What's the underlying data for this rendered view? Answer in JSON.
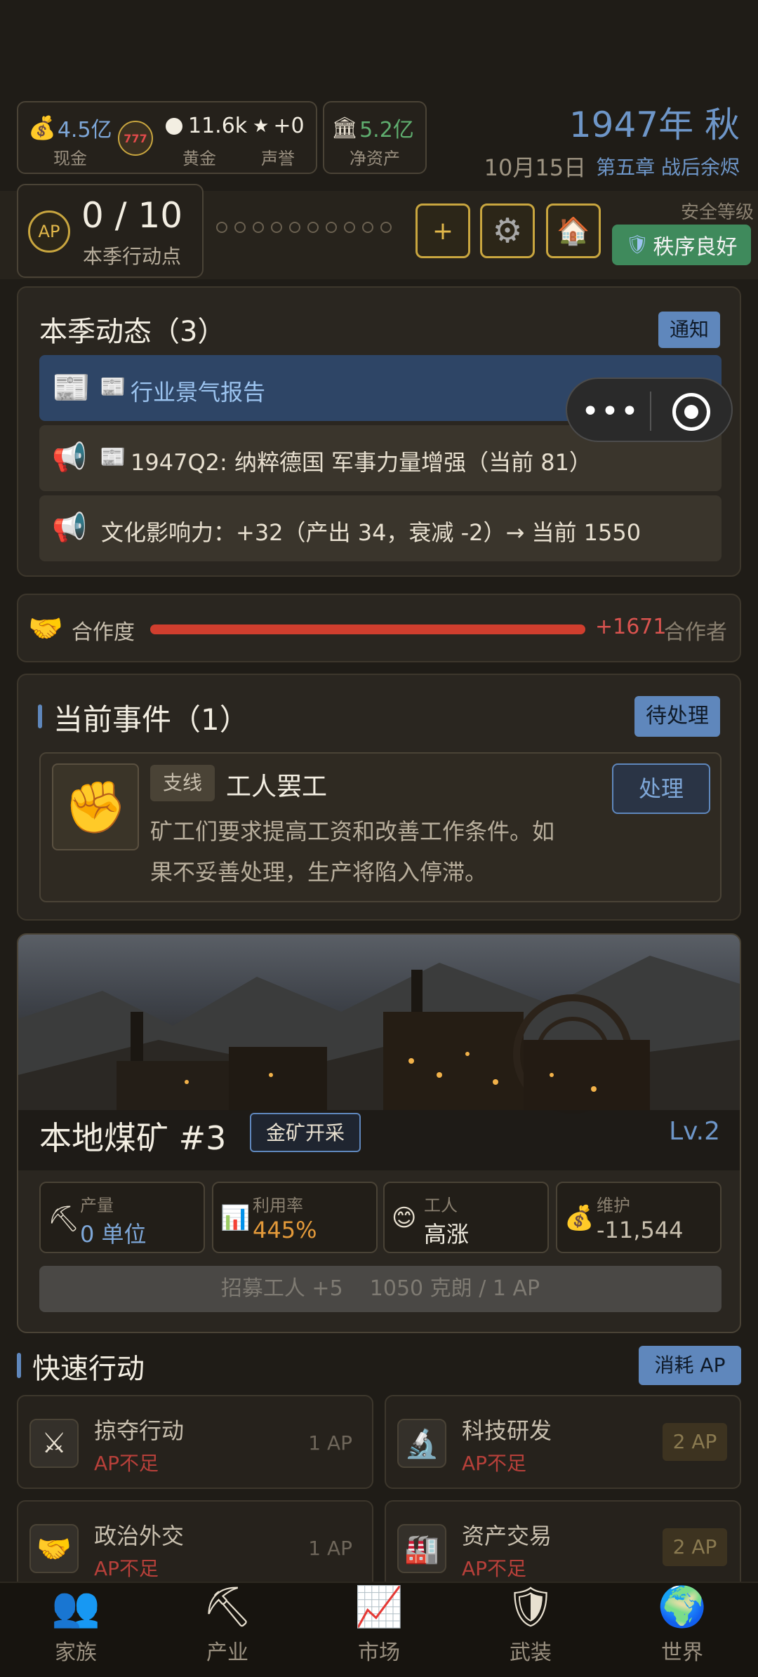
{
  "header": {
    "cash": {
      "value": "4.5亿",
      "label": "现金"
    },
    "gold": {
      "value": "11.6k",
      "label": "黄金"
    },
    "reputation": {
      "value": "+0",
      "label": "声誉"
    },
    "net_assets": {
      "value": "5.2亿",
      "label": "净资产"
    },
    "date_big": "1947年 秋",
    "date_small": "10月15日",
    "chapter": "第五章 战后余烬"
  },
  "ap": {
    "badge": "AP",
    "value": "0 / 10",
    "label": "本季行动点",
    "dots_total": 10,
    "security_label": "安全等级",
    "security_value": "秩序良好"
  },
  "season_events": {
    "title": "本季动态（3）",
    "notify_label": "通知",
    "items": [
      {
        "text": "行业景气报告"
      },
      {
        "text": "1947Q2: 纳粹德国 军事力量增强（当前 81）"
      },
      {
        "text": "文化影响力：+32（产出 34，衰减 -2）→ 当前 1550"
      }
    ]
  },
  "cooperation": {
    "label": "合作度",
    "value_text": "+1671",
    "right_label": "合作者",
    "fill_percent": 100
  },
  "current_events": {
    "title": "当前事件（1）",
    "pending_label": "待处理",
    "event": {
      "tag": "支线",
      "title": "工人罢工",
      "description_line1": "矿工们要求提高工资和改善工作条件。如",
      "description_line2": "果不妥善处理，生产将陷入停滞。",
      "action_label": "处理"
    }
  },
  "mine": {
    "name": "本地煤矿 #3",
    "type_tag": "金矿开采",
    "level": "Lv.2",
    "stats": [
      {
        "label": "产量",
        "value": "0 单位",
        "icon": "pickaxe-icon"
      },
      {
        "label": "利用率",
        "value": "445%",
        "icon": "chart-icon"
      },
      {
        "label": "工人",
        "value": "高涨",
        "icon": "smile-icon"
      },
      {
        "label": "维护",
        "value": "-11,544",
        "icon": "money-bag-icon"
      }
    ],
    "recruit_label": "招募工人 +5    1050 克朗 / 1 AP"
  },
  "quick_actions": {
    "title": "快速行动",
    "cost_label": "消耗 AP",
    "items": [
      {
        "name": "掠夺行动",
        "status": "AP不足",
        "cost": "1 AP"
      },
      {
        "name": "科技研发",
        "status": "AP不足",
        "cost": "2 AP"
      },
      {
        "name": "政治外交",
        "status": "AP不足",
        "cost": "1 AP"
      },
      {
        "name": "资产交易",
        "status": "AP不足",
        "cost": "2 AP"
      }
    ]
  },
  "nav": {
    "items": [
      {
        "label": "家族"
      },
      {
        "label": "产业"
      },
      {
        "label": "市场"
      },
      {
        "label": "武装"
      },
      {
        "label": "世界"
      }
    ]
  },
  "colors": {
    "accent_blue": "#7ea7d8",
    "gold": "#e2b84a",
    "danger_red": "#d9534f",
    "security_green": "#3f8a5c"
  }
}
